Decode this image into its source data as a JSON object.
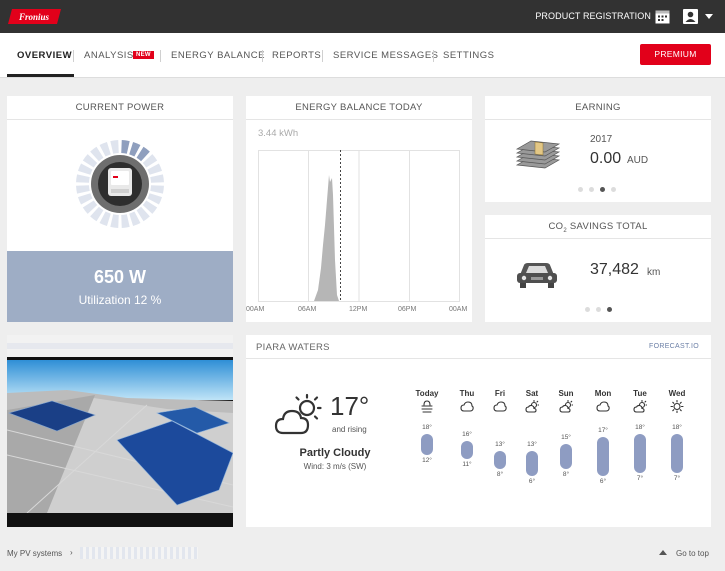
{
  "topbar": {
    "logo_text": "Fronius",
    "product_registration": "PRODUCT REGISTRATION"
  },
  "nav": {
    "tabs": [
      {
        "label": "OVERVIEW",
        "active": true
      },
      {
        "label": "ANALYSIS",
        "active": false
      },
      {
        "label": "ENERGY BALANCE",
        "active": false
      },
      {
        "label": "REPORTS",
        "active": false
      },
      {
        "label": "SERVICE MESSAGES",
        "active": false
      },
      {
        "label": "SETTINGS",
        "active": false
      }
    ],
    "new_badge": "NEW",
    "premium_label": "PREMIUM"
  },
  "current_power": {
    "title": "CURRENT POWER",
    "value": "650 W",
    "utilization": "Utilization 12 %",
    "utilization_fraction": 0.12
  },
  "energy_balance": {
    "title": "ENERGY BALANCE TODAY",
    "total": "3.44 kWh",
    "x_ticks": [
      "00AM",
      "06AM",
      "12PM",
      "06PM",
      "00AM"
    ]
  },
  "earning": {
    "title": "EARNING",
    "year": "2017",
    "value": "0.00",
    "currency": "AUD"
  },
  "co2": {
    "title_pre": "CO",
    "title_sub": "2",
    "title_post": " SAVINGS TOTAL",
    "value": "37,482",
    "unit": "km"
  },
  "weather": {
    "location": "PIARA WATERS",
    "source": "FORECAST.IO",
    "temp": "17°",
    "trend": "and rising",
    "condition": "Partly Cloudy",
    "wind": "Wind: 3 m/s (SW)",
    "forecast": [
      {
        "day": "Today",
        "hi": "18°",
        "lo": "12°",
        "icon": "fog-icon"
      },
      {
        "day": "Thu",
        "hi": "16°",
        "lo": "11°",
        "icon": "cloud-icon"
      },
      {
        "day": "Fri",
        "hi": "13°",
        "lo": "8°",
        "icon": "cloud-icon"
      },
      {
        "day": "Sat",
        "hi": "13°",
        "lo": "6°",
        "icon": "partly-cloudy-icon"
      },
      {
        "day": "Sun",
        "hi": "15°",
        "lo": "8°",
        "icon": "partly-cloudy-icon"
      },
      {
        "day": "Mon",
        "hi": "17°",
        "lo": "6°",
        "icon": "cloud-icon"
      },
      {
        "day": "Tue",
        "hi": "18°",
        "lo": "7°",
        "icon": "partly-cloudy-icon"
      },
      {
        "day": "Wed",
        "hi": "18°",
        "lo": "7°",
        "icon": "sun-icon"
      }
    ]
  },
  "footer": {
    "breadcrumb": "My PV systems",
    "go_to_top": "Go to top"
  }
}
